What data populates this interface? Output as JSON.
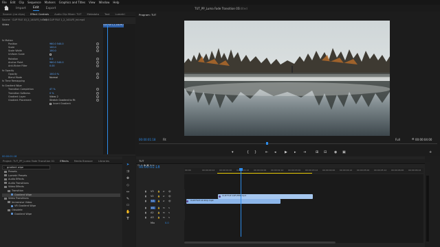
{
  "menu": [
    "File",
    "Edit",
    "Clip",
    "Sequence",
    "Markers",
    "Graphics and Titles",
    "View",
    "Window",
    "Help"
  ],
  "workspace": {
    "tabs": [
      "Import",
      "Edit",
      "Export"
    ],
    "active": "Edit",
    "title": "TUT_PP_Luma Fade Transition 01",
    "status": "Edited"
  },
  "source_panel": {
    "tabs": [
      "Source: (no clips)",
      "Effect Controls",
      "Audio Clip Mixer: TUT",
      "Metadata",
      "Text",
      "Lumetri"
    ],
    "active": "Effect Controls",
    "clip_header": "Source · CLIP FILE 10_2_140LFE_hd.mp4",
    "sequence_header": "TUT · CLIP FILE 1_2_141LFE_hd.mp4",
    "mini_clip": "CLIP FILE 1_2_141LFE_hd.mp4",
    "section_video": "Video",
    "properties": [
      {
        "label": "fx  Motion",
        "value": ""
      },
      {
        "label": "Position",
        "value": "960.0   540.0"
      },
      {
        "label": "Scale",
        "value": "100.0"
      },
      {
        "label": "Scale Width",
        "value": "100.0"
      },
      {
        "label": "Uniform Scale",
        "value": ""
      },
      {
        "label": "Rotation",
        "value": "0.0"
      },
      {
        "label": "Anchor Point",
        "value": "960.0   540.0"
      },
      {
        "label": "Anti-flicker Filter",
        "value": "0.00"
      },
      {
        "label": "fx  Opacity",
        "value": ""
      },
      {
        "label": "Opacity",
        "value": "100.0 %"
      },
      {
        "label": "Blend Mode",
        "value": "Normal"
      },
      {
        "label": "fx  Time Remapping",
        "value": ""
      },
      {
        "label": "fx  Gradient Wipe",
        "value": ""
      },
      {
        "label": "Transition Completion",
        "value": "47 %"
      },
      {
        "label": "Transition Softness",
        "value": "0 %"
      },
      {
        "label": "Gradient Layer",
        "value": "Video 2"
      },
      {
        "label": "Gradient Placement",
        "value": "Stretch Gradient to Fit"
      },
      {
        "label": "",
        "value": "Invert Gradient"
      }
    ],
    "timecode": "00:00:01:18"
  },
  "program": {
    "title": "Program: TUT",
    "timecode": "00:00:01:18",
    "fit": "Fit",
    "quality": "Full",
    "duration": "00:00:04:00"
  },
  "project_panel": {
    "tabs": [
      "Project: TUT_PP_Luma Fade Transition 01",
      "Effects",
      "Media Browser",
      "Libraries"
    ],
    "active": "Effects",
    "search": "gradient wipe",
    "tree": [
      {
        "label": "Presets",
        "indent": 0,
        "folder": true
      },
      {
        "label": "Lumetri Presets",
        "indent": 0,
        "folder": true
      },
      {
        "label": "Audio Effects",
        "indent": 0,
        "folder": true
      },
      {
        "label": "Audio Transitions",
        "indent": 0,
        "folder": true
      },
      {
        "label": "Video Effects",
        "indent": 0,
        "folder": true
      },
      {
        "label": "Transition",
        "indent": 1,
        "folder": true
      },
      {
        "label": "Gradient Wipe",
        "indent": 2,
        "folder": false,
        "selected": true
      },
      {
        "label": "Video Transitions",
        "indent": 0,
        "folder": true
      },
      {
        "label": "Immersive Video",
        "indent": 1,
        "folder": true
      },
      {
        "label": "VR Gradient Wipe",
        "indent": 2,
        "folder": false
      },
      {
        "label": "Obsolete",
        "indent": 1,
        "folder": true
      },
      {
        "label": "Gradient Wipe",
        "indent": 2,
        "folder": false
      }
    ]
  },
  "timeline": {
    "title": "TUT",
    "timecode": "00:00:01:18",
    "ruler": [
      "00:00",
      "00:00:00:12",
      "00:00:01:00",
      "00:00:01:12",
      "00:00:02:00",
      "00:00:02:12",
      "00:00:03:00",
      "00:00:03:12",
      "00:00:04:00",
      "00:00:04:12",
      "00:00:05:00",
      "00:00:05:12",
      "00:00:06:00",
      "00:00:06:12"
    ],
    "tracks": [
      {
        "name": "V3"
      },
      {
        "name": "V2"
      },
      {
        "name": "V1",
        "selected": true
      },
      {
        "name": "A1",
        "selected": true
      },
      {
        "name": "A2"
      },
      {
        "name": "A3"
      }
    ],
    "mix": {
      "label": "Mix",
      "value": "0.0"
    },
    "clip_v2": "CLIP FILE 10FLFE9.mp4",
    "clip_v1": "CLIP FILE 14.Ship.mp4"
  },
  "colors": {
    "accent": "#2d8ceb",
    "clip_v2": "#a6c7ef",
    "clip_v1": "#8cb6ea",
    "playhead": "#2d8ceb"
  }
}
